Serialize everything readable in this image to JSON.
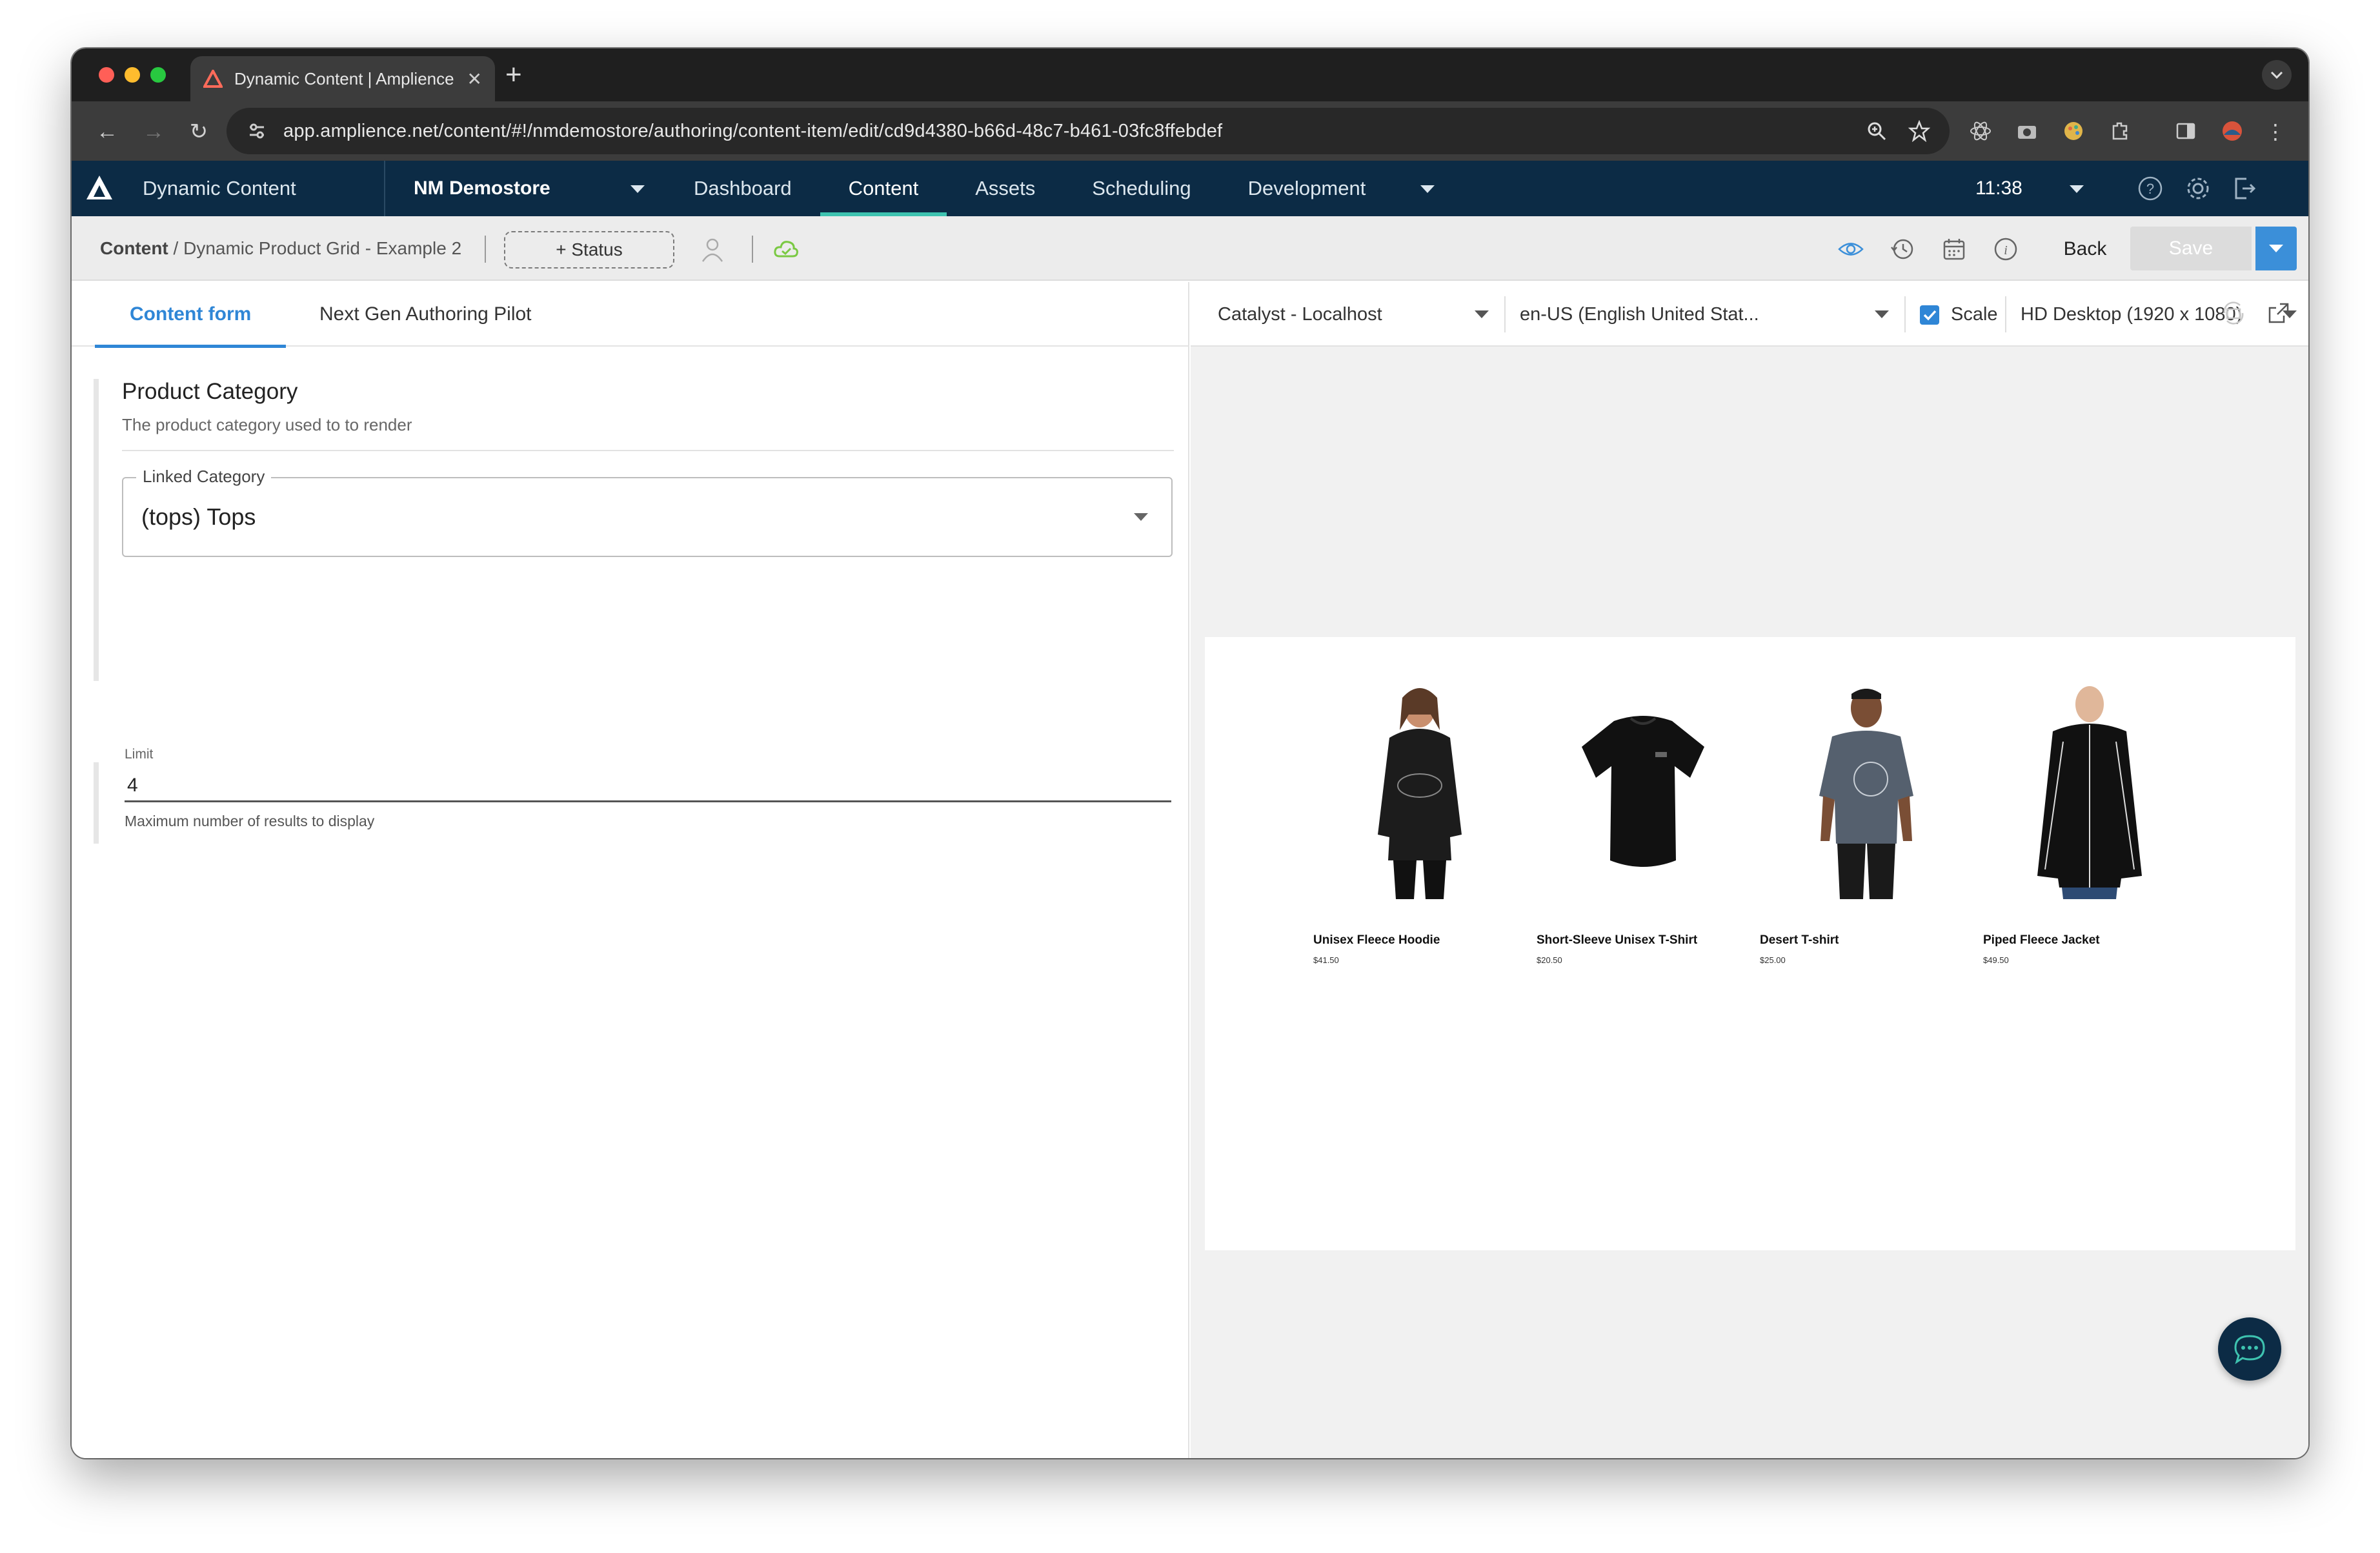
{
  "browser": {
    "tab_title": "Dynamic Content | Amplience",
    "url": "app.amplience.net/content/#!/nmdemostore/authoring/content-item/edit/cd9d4380-b66d-48c7-b461-03fc8ffebdef"
  },
  "header": {
    "brand": "Dynamic Content",
    "hub": "NM Demostore",
    "nav": [
      "Dashboard",
      "Content",
      "Assets",
      "Scheduling",
      "Development"
    ],
    "active_nav": "Content",
    "time": "11:38",
    "accent_color": "#3ec3b0"
  },
  "toolbar": {
    "breadcrumb_root": "Content",
    "breadcrumb_item": "/ Dynamic Product Grid - Example 2",
    "status_label": "+ Status",
    "back_label": "Back",
    "save_label": "Save"
  },
  "form": {
    "tabs": [
      "Content form",
      "Next Gen Authoring Pilot"
    ],
    "section_title": "Product Category",
    "section_desc": "The product category used to to render",
    "linked_label": "Linked Category",
    "linked_value": "(tops) Tops",
    "limit_label": "Limit",
    "limit_value": "4",
    "limit_help": "Maximum number of results to display"
  },
  "preview": {
    "visualization": "Catalyst - Localhost",
    "locale": "en-US (English United Stat...",
    "scale_label": "Scale",
    "scale_checked": true,
    "device": "HD Desktop (1920 x 1080)",
    "products": [
      {
        "name": "Unisex Fleece Hoodie",
        "price": "$41.50"
      },
      {
        "name": "Short-Sleeve Unisex T-Shirt",
        "price": "$20.50"
      },
      {
        "name": "Desert T-shirt",
        "price": "$25.00"
      },
      {
        "name": "Piped Fleece Jacket",
        "price": "$49.50"
      }
    ]
  }
}
